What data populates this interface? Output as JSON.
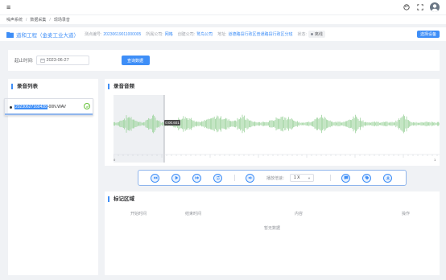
{
  "topbar": {
    "menu_icon": "hamburger-icon",
    "icons": [
      "palette-icon",
      "fullscreen-icon",
      "avatar"
    ]
  },
  "breadcrumb": {
    "items": [
      "噪声系统",
      "数据采集",
      "现场录音"
    ]
  },
  "project": {
    "name": "道和工程（金麦工业大道）",
    "fields": [
      {
        "key": "测点编号:",
        "value": "20230619011000005"
      },
      {
        "key": "所属公司:",
        "value": "网格"
      },
      {
        "key": "创建公司:",
        "value": "鹫鸟公司"
      },
      {
        "key": "地址:",
        "value": "道德路段行政区普通路段行政区分班"
      }
    ],
    "state_key": "状态:",
    "state_value": "离线",
    "select_device": "选择设备"
  },
  "filter": {
    "label": "起止时间:",
    "date_value": "2023-06-27",
    "query_button": "查询数据"
  },
  "recording_list": {
    "title": "录音列表",
    "files": [
      {
        "name_highlight": "20230627160428",
        "name_rest": "-00N.WAV",
        "checked": true
      }
    ]
  },
  "waveform": {
    "title": "录音音频",
    "cursor_time": "0:00.601",
    "scale_start": "0",
    "scale_end": "1",
    "wave_color": "#9fd49f"
  },
  "player": {
    "speed_label": "播放倍速：",
    "speed_value": "1 X"
  },
  "marks": {
    "title": "标记区域",
    "columns": [
      "开始时间",
      "结束时间",
      "内容",
      "操作"
    ],
    "empty_text": "暂无数据"
  },
  "colors": {
    "accent": "#3e8ef7",
    "success": "#67c23a"
  }
}
